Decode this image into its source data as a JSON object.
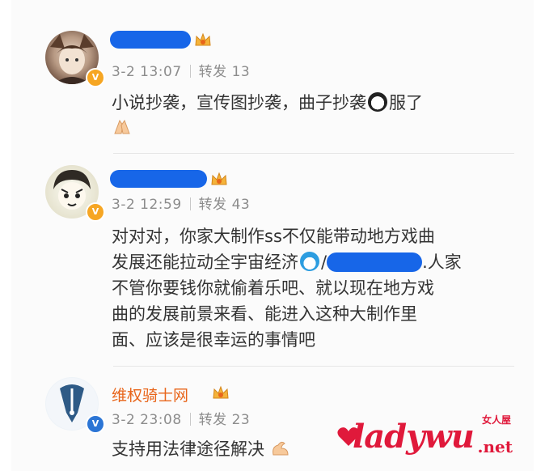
{
  "comments": [
    {
      "author": "",
      "date": "3-2 13:07",
      "repost_label": "转发",
      "repost_count": "13",
      "text": "小说抄袭，宣传图抄袭，曲子抄袭",
      "text_tail": "服了"
    },
    {
      "author": "",
      "date": "3-2 12:59",
      "repost_label": "转发",
      "repost_count": "43",
      "line1": "对对对，你家大制作ss不仅能带动地方戏曲",
      "line2_a": "发展还能拉动全宇宙经济",
      "line2_b": "/",
      "line2_c": ".人家",
      "line3": "不管你要钱你就偷着乐吧、就以现在地方戏",
      "line4": "曲的发展前景来看、能进入这种大制作里",
      "line5": "面、应该是很幸运的事情吧"
    },
    {
      "author": "维权骑士网",
      "date": "3-2 23:08",
      "repost_label": "转发",
      "repost_count": "23",
      "text": "支持用法律途径解决"
    }
  ],
  "watermark": {
    "main": "ladywu",
    "net": ".net",
    "top": "女人屋"
  },
  "colors": {
    "redaction": "#1766e8",
    "author_orange": "#e8651a",
    "watermark_red": "#e0193b",
    "vip_badge": "#f6a623",
    "verified_blue": "#2b75d5"
  },
  "icons": [
    "crown-icon",
    "panda-emoji-icon",
    "clap-hands-icon",
    "doraemon-emoji-icon",
    "flex-arm-icon",
    "verified-badge-icon"
  ]
}
